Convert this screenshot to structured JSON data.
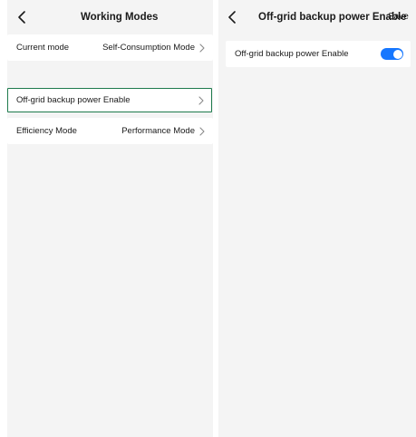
{
  "left_screen": {
    "title": "Working Modes",
    "back_icon": "chevron-left-icon",
    "rows": [
      {
        "label": "Current mode",
        "value": "Self-Consumption Mode"
      },
      {
        "label": "Off-grid backup power Enable",
        "value": ""
      },
      {
        "label": "Efficiency Mode",
        "value": "Performance Mode"
      }
    ],
    "selected_row_border_color": "#1e7a4c"
  },
  "right_screen": {
    "title": "Off-grid backup power Enable",
    "back_icon": "chevron-left-icon",
    "save_label": "Save",
    "setting": {
      "label": "Off-grid backup power Enable",
      "enabled": true,
      "toggle_color": "#1677ff"
    }
  },
  "colors": {
    "panel_background": "#f4f4f4",
    "row_background": "#ffffff",
    "text": "#1a1a1a"
  }
}
